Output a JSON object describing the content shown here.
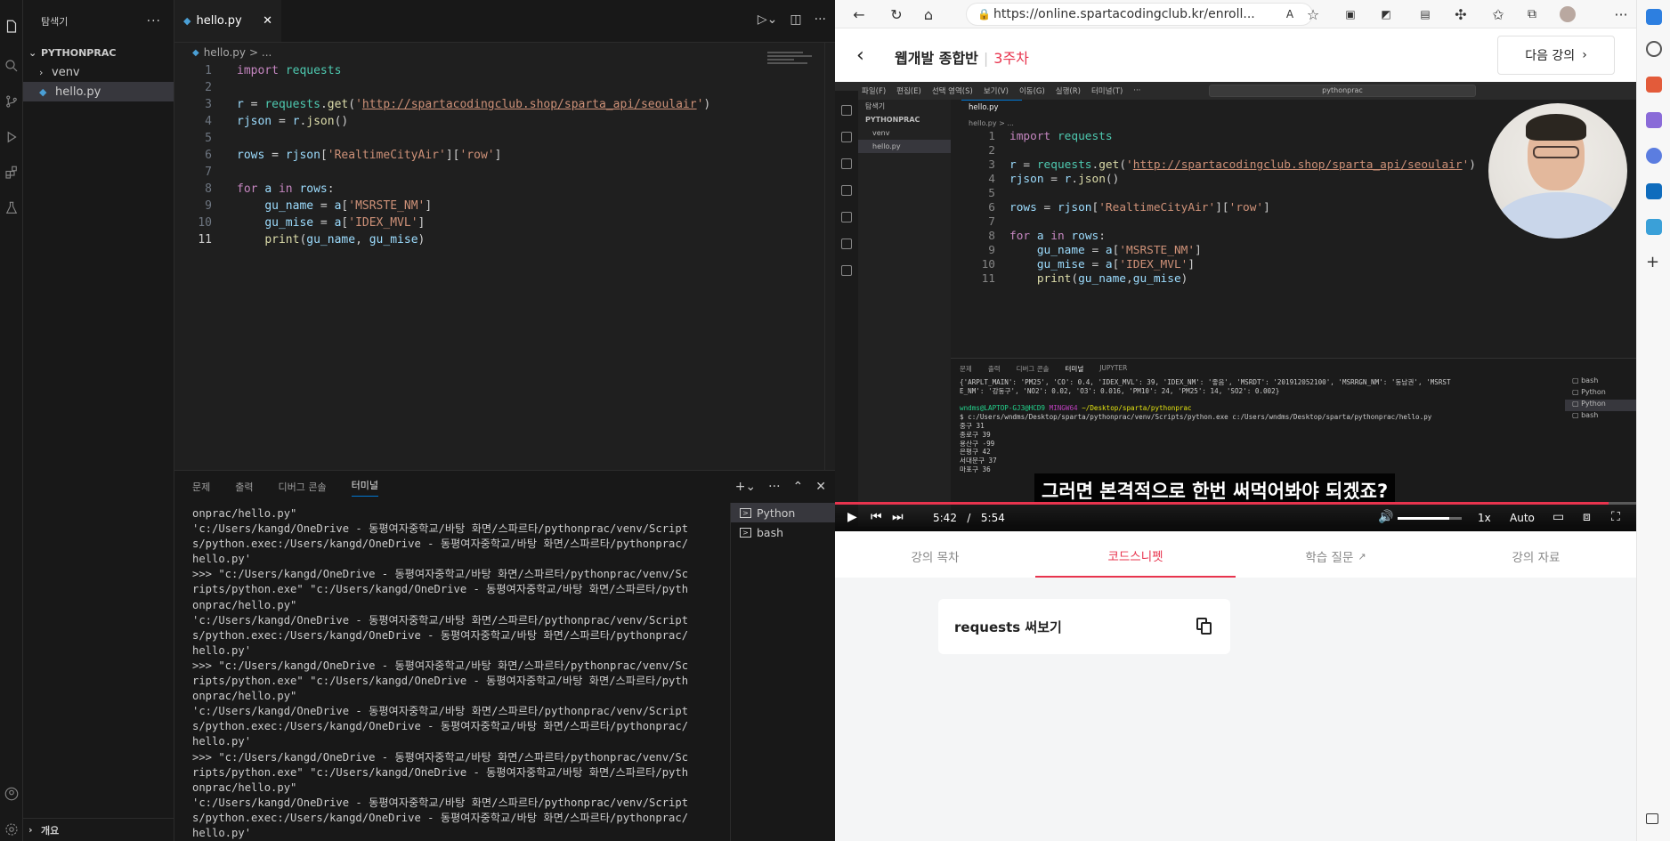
{
  "vscode": {
    "explorer_title": "탐색기",
    "folder_name": "PYTHONPRAC",
    "tree": [
      {
        "label": "venv",
        "type": "folder"
      },
      {
        "label": "hello.py",
        "type": "file"
      }
    ],
    "outline_label": "개요",
    "tab_label": "hello.py",
    "breadcrumb_file": "hello.py",
    "breadcrumb_rest": "> ...",
    "code_lines": [
      {
        "n": "1",
        "html": "<span class=\"kw\">import</span> <span class=\"mod\">requests</span>"
      },
      {
        "n": "2",
        "html": ""
      },
      {
        "n": "3",
        "html": "<span class=\"vr\">r</span> = <span class=\"mod\">requests</span>.<span class=\"fn\">get</span>(<span class=\"st\">'</span><span class=\"url\">http://spartacodingclub.shop/sparta_api/seoulair</span><span class=\"st\">'</span>)"
      },
      {
        "n": "4",
        "html": "<span class=\"vr\">rjson</span> = <span class=\"vr\">r</span>.<span class=\"fn\">json</span>()"
      },
      {
        "n": "5",
        "html": ""
      },
      {
        "n": "6",
        "html": "<span class=\"vr\">rows</span> = <span class=\"vr\">rjson</span>[<span class=\"st\">'RealtimeCityAir'</span>][<span class=\"st\">'row'</span>]"
      },
      {
        "n": "7",
        "html": ""
      },
      {
        "n": "8",
        "html": "<span class=\"kw\">for</span> <span class=\"vr\">a</span> <span class=\"kw\">in</span> <span class=\"vr\">rows</span>:"
      },
      {
        "n": "9",
        "html": "    <span class=\"vr\">gu_name</span> = <span class=\"vr\">a</span>[<span class=\"st\">'MSRSTE_NM'</span>]"
      },
      {
        "n": "10",
        "html": "    <span class=\"vr\">gu_mise</span> = <span class=\"vr\">a</span>[<span class=\"st\">'IDEX_MVL'</span>]"
      },
      {
        "n": "11",
        "html": "    <span class=\"fn\">print</span>(<span class=\"vr\">gu_name</span>, <span class=\"vr\">gu_mise</span>)"
      }
    ],
    "panel_tabs": [
      "문제",
      "출력",
      "디버그 콘솔",
      "터미널"
    ],
    "panel_active": "터미널",
    "terminal_text": "onprac/hello.py\"\n'c:/Users/kangd/OneDrive - 동평여자중학교/바탕 화면/스파르타/pythonprac/venv/Script\ns/python.exec:/Users/kangd/OneDrive - 동평여자중학교/바탕 화면/스파르타/pythonprac/\nhello.py'\n>>> \"c:/Users/kangd/OneDrive - 동평여자중학교/바탕 화면/스파르타/pythonprac/venv/Sc\nripts/python.exe\" \"c:/Users/kangd/OneDrive - 동평여자중학교/바탕 화면/스파르타/pyth\nonprac/hello.py\"\n'c:/Users/kangd/OneDrive - 동평여자중학교/바탕 화면/스파르타/pythonprac/venv/Script\ns/python.exec:/Users/kangd/OneDrive - 동평여자중학교/바탕 화면/스파르타/pythonprac/\nhello.py'\n>>> \"c:/Users/kangd/OneDrive - 동평여자중학교/바탕 화면/스파르타/pythonprac/venv/Sc\nripts/python.exe\" \"c:/Users/kangd/OneDrive - 동평여자중학교/바탕 화면/스파르타/pyth\nonprac/hello.py\"\n'c:/Users/kangd/OneDrive - 동평여자중학교/바탕 화면/스파르타/pythonprac/venv/Script\ns/python.exec:/Users/kangd/OneDrive - 동평여자중학교/바탕 화면/스파르타/pythonprac/\nhello.py'\n>>> \"c:/Users/kangd/OneDrive - 동평여자중학교/바탕 화면/스파르타/pythonprac/venv/Sc\nripts/python.exe\" \"c:/Users/kangd/OneDrive - 동평여자중학교/바탕 화면/스파르타/pyth\nonprac/hello.py\"\n'c:/Users/kangd/OneDrive - 동평여자중학교/바탕 화면/스파르타/pythonprac/venv/Script\ns/python.exec:/Users/kangd/OneDrive - 동평여자중학교/바탕 화면/스파르타/pythonprac/\nhello.py'",
    "terminal_list": [
      {
        "label": "Python",
        "active": true
      },
      {
        "label": "bash",
        "active": false
      }
    ]
  },
  "browser": {
    "url": "https://online.spartacodingclub.kr/enroll...",
    "course_title": "웹개발 종합반",
    "course_week": "3주차",
    "next_label": "다음 강의",
    "video": {
      "v_menu": [
        "파일(F)",
        "편집(E)",
        "선택 영역(S)",
        "보기(V)",
        "이동(G)",
        "실행(R)",
        "터미널(T)",
        "···"
      ],
      "v_search": "pythonprac",
      "v_sidebar": [
        "탐색기",
        "PYTHONPRAC",
        "venv",
        "hello.py"
      ],
      "v_tab": "hello.py",
      "v_bread": "hello.py > ...",
      "v_code": [
        {
          "n": "1",
          "html": "<span class=\"kw\">import</span> <span class=\"mod\">requests</span>"
        },
        {
          "n": "2",
          "html": ""
        },
        {
          "n": "3",
          "html": "<span class=\"vr\">r</span> = <span class=\"mod\">requests</span>.<span class=\"fn\">get</span>(<span class=\"st\">'</span><span class=\"url\">http://spartacodingclub.shop/sparta_api/seoulair</span><span class=\"st\">'</span>)"
        },
        {
          "n": "4",
          "html": "<span class=\"vr\">rjson</span> = <span class=\"vr\">r</span>.<span class=\"fn\">json</span>()"
        },
        {
          "n": "5",
          "html": ""
        },
        {
          "n": "6",
          "html": "<span class=\"vr\">rows</span> = <span class=\"vr\">rjson</span>[<span class=\"st\">'RealtimeCityAir'</span>][<span class=\"st\">'row'</span>]"
        },
        {
          "n": "7",
          "html": ""
        },
        {
          "n": "8",
          "html": "<span class=\"kw\">for</span> <span class=\"vr\">a</span> <span class=\"kw\">in</span> <span class=\"vr\">rows</span>:"
        },
        {
          "n": "9",
          "html": "    <span class=\"vr\">gu_name</span> = <span class=\"vr\">a</span>[<span class=\"st\">'MSRSTE_NM'</span>]"
        },
        {
          "n": "10",
          "html": "    <span class=\"vr\">gu_mise</span> = <span class=\"vr\">a</span>[<span class=\"st\">'IDEX_MVL'</span>]"
        },
        {
          "n": "11",
          "html": "    <span class=\"fn\">print</span>(<span class=\"vr\">gu_name</span>,<span class=\"vr\">gu_mise</span>)"
        }
      ],
      "v_panel_tabs": [
        "문제",
        "출력",
        "디버그 콘솔",
        "터미널",
        "JUPYTER"
      ],
      "v_term_html": "{'ARPLT_MAIN': 'PM25', 'CO': 0.4, 'IDEX_MVL': 39, 'IDEX_NM': '좋음', 'MSRDT': '201912052100', 'MSRRGN_NM': '동남권', 'MSRST\nE_NM': '강동구', 'NO2': 0.02, 'O3': 0.016, 'PM10': 24, 'PM25': 14, 'SO2': 0.002}\n\n<span class=\"g\">wndms@LAPTOP-GJ3@HCD9</span> <span class=\"p\">MINGW64</span> <span class=\"y\">~/Desktop/sparta/pythonprac</span>\n$ c:/Users/wndms/Desktop/sparta/pythonprac/venv/Scripts/python.exe c:/Users/wndms/Desktop/sparta/pythonprac/hello.py\n중구 31\n종로구 39\n용산구 -99\n은평구 42\n서대문구 37\n마포구 36",
      "v_termlist": [
        {
          "label": "bash",
          "active": false
        },
        {
          "label": "Python",
          "active": false
        },
        {
          "label": "Python",
          "active": true
        },
        {
          "label": "bash",
          "active": false
        }
      ],
      "subtitle": "그러면 본격적으로 한번 써먹어봐야 되겠죠?",
      "time_current": "5:42",
      "time_sep": "/",
      "time_total": "5:54",
      "progress": 0.966,
      "volume": 0.8,
      "speed": "1x",
      "quality": "Auto"
    },
    "course_tabs": [
      {
        "label": "강의 목차",
        "active": false
      },
      {
        "label": "코드스니펫",
        "active": true
      },
      {
        "label": "학습 질문",
        "active": false,
        "external": true
      },
      {
        "label": "강의 자료",
        "active": false
      }
    ],
    "snippet_title": "requests 써보기"
  }
}
